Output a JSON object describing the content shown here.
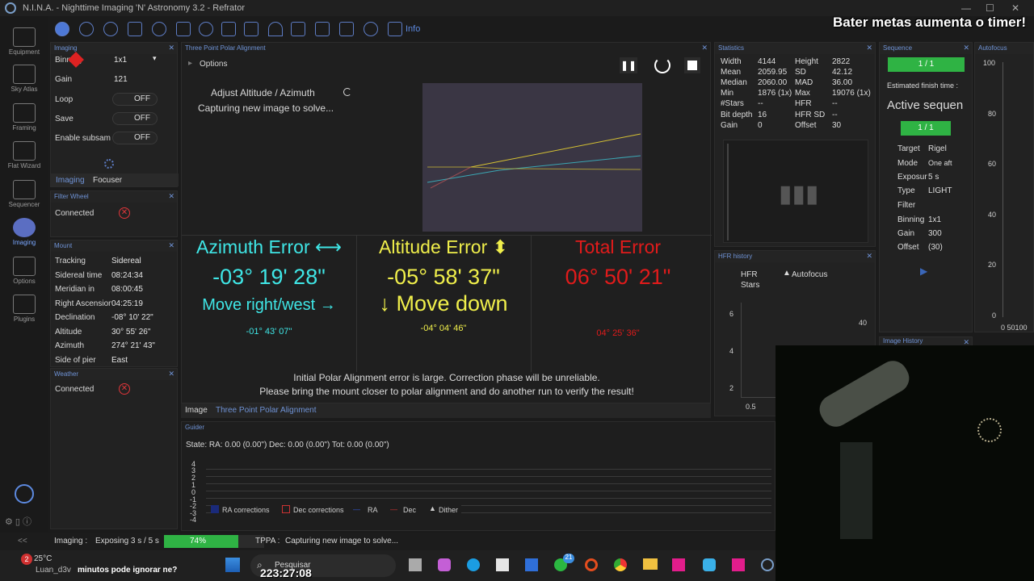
{
  "window": {
    "title": "N.I.N.A. - Nighttime Imaging 'N' Astronomy 3.2 - Refrator"
  },
  "nav": [
    {
      "label": "Equipment"
    },
    {
      "label": "Sky Atlas"
    },
    {
      "label": "Framing"
    },
    {
      "label": "Flat Wizard"
    },
    {
      "label": "Sequencer"
    },
    {
      "label": "Imaging"
    },
    {
      "label": "Options"
    },
    {
      "label": "Plugins"
    }
  ],
  "toolbar": {
    "info_label": "Info"
  },
  "imaging_panel": {
    "title": "Imaging",
    "binning_label": "Binning",
    "binning_value": "1x1",
    "gain_label": "Gain",
    "gain_value": "121",
    "loop_label": "Loop",
    "loop_value": "OFF",
    "save_label": "Save",
    "save_value": "OFF",
    "subsample_label": "Enable subsam",
    "subsample_value": "OFF",
    "tabs": [
      "Imaging",
      "Focuser"
    ]
  },
  "filter_wheel": {
    "title": "Filter Wheel",
    "connected_label": "Connected"
  },
  "mount": {
    "title": "Mount",
    "rows": [
      {
        "label": "Tracking",
        "value": "Sidereal"
      },
      {
        "label": "Sidereal time",
        "value": "08:24:34"
      },
      {
        "label": "Meridian in",
        "value": "08:00:45"
      },
      {
        "label": "Right Ascension",
        "value": "04:25:19"
      },
      {
        "label": "Declination",
        "value": "-08° 10' 22\""
      },
      {
        "label": "Altitude",
        "value": "30° 55' 26\""
      },
      {
        "label": "Azimuth",
        "value": "274° 21' 43\""
      },
      {
        "label": "Side of pier",
        "value": "East"
      }
    ]
  },
  "weather": {
    "title": "Weather",
    "connected_label": "Connected"
  },
  "tppa": {
    "title": "Three Point Polar Alignment",
    "options_label": "Options",
    "step_label": "Adjust Altitude / Azimuth",
    "status_label": "Capturing new image to solve...",
    "azimuth": {
      "title": "Azimuth Error ⟷",
      "value": "-03° 19' 28\"",
      "hint": "Move right/west →",
      "sub": "-01° 43' 07\""
    },
    "altitude": {
      "title": "Altitude Error ⬍",
      "value": "-05° 58' 37\"",
      "hint": "↓ Move down",
      "sub": "-04° 04' 46\""
    },
    "total": {
      "title": "Total Error",
      "value": "06° 50' 21\"",
      "sub": "04° 25' 36\""
    },
    "warning_1": "Initial Polar Alignment error is large. Correction phase will be unreliable.",
    "warning_2": "Please bring the mount closer to polar alignment and do another run to verify the result!",
    "tabs": [
      "Image",
      "Three Point Polar Alignment"
    ],
    "colors": {
      "azimuth": "#3fe6e6",
      "altitude": "#f0ef4b",
      "total": "#e11b1b"
    }
  },
  "statistics": {
    "title": "Statistics",
    "rows": [
      {
        "l1": "Width",
        "v1": "4144",
        "l2": "Height",
        "v2": "2822"
      },
      {
        "l1": "Mean",
        "v1": "2059.95",
        "l2": "SD",
        "v2": "42.12"
      },
      {
        "l1": "Median",
        "v1": "2060.00",
        "l2": "MAD",
        "v2": "36.00"
      },
      {
        "l1": "Min",
        "v1": "1876 (1x)",
        "l2": "Max",
        "v2": "19076 (1x)"
      },
      {
        "l1": "#Stars",
        "v1": "--",
        "l2": "HFR",
        "v2": "--"
      },
      {
        "l1": "Bit depth",
        "v1": "16",
        "l2": "HFR SD",
        "v2": "--"
      },
      {
        "l1": "Gain",
        "v1": "0",
        "l2": "Offset",
        "v2": "30"
      }
    ]
  },
  "hfr_history": {
    "title": "HFR history",
    "legend_hfr": "HFR",
    "legend_autofocus": "Autofocus",
    "legend_stars": "Stars",
    "y_ticks": [
      "6",
      "4",
      "2"
    ],
    "right_tick": "40",
    "x_tick": "0.5"
  },
  "sequence": {
    "title": "Sequence",
    "progress_1": "1 / 1",
    "finish_label": "Estimated finish time :",
    "active_label": "Active sequen",
    "progress_2": "1 / 1",
    "rows": [
      {
        "label": "Target",
        "value": "Rigel"
      },
      {
        "label": "Mode",
        "value": "One aft"
      },
      {
        "label": "Exposur",
        "value": "5 s"
      },
      {
        "label": "Type",
        "value": "LIGHT"
      },
      {
        "label": "Filter",
        "value": ""
      },
      {
        "label": "Binning",
        "value": "1x1"
      },
      {
        "label": "Gain",
        "value": "300"
      },
      {
        "label": "Offset",
        "value": "(30)"
      }
    ]
  },
  "image_history": {
    "title": "Image History"
  },
  "autofocus": {
    "title": "Autofocus",
    "y_ticks": [
      "100",
      "80",
      "60",
      "40",
      "20",
      "0"
    ],
    "x_ticks": "0 50100"
  },
  "guider": {
    "title": "Guider",
    "state": "State:  RA: 0.00 (0.00\")  Dec: 0.00 (0.00\")  Tot: 0.00 (0.00\")",
    "y_ticks": [
      "4",
      "3",
      "2",
      "1",
      "0",
      "-1",
      "-2",
      "-3",
      "-4"
    ],
    "legend": [
      "RA corrections",
      "Dec corrections",
      "RA",
      "Dec",
      "Dither"
    ]
  },
  "status": {
    "collapse": "<<",
    "imaging_label": "Imaging :",
    "exposing": "Exposing 3 s / 5 s",
    "progress_label": "74%",
    "progress": 0.74,
    "tppa_label": "TPPA :",
    "tppa_status": "Capturing new image to solve..."
  },
  "taskbar": {
    "temp": "25°C",
    "badge": "2",
    "search": "Pesquisar",
    "chat_user": "Luan_d3v",
    "chat_msg": "minutos pode ignorar ne?",
    "clock": "223:27:08",
    "notif": "21"
  },
  "overlay": {
    "text": "Bater metas aumenta o timer!"
  }
}
